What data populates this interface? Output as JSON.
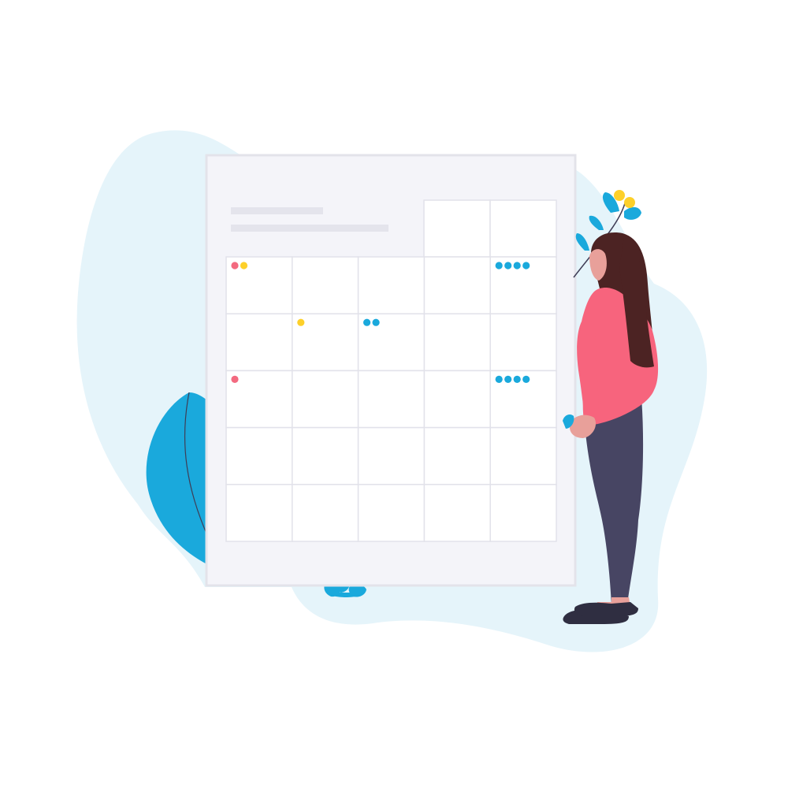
{
  "illustration": {
    "subject": "woman-looking-at-calendar",
    "colors": {
      "background": "#ffffff",
      "blob": "#e5f4fa",
      "board": "#f4f4f9",
      "board_border": "#e3e3ea",
      "cell": "#ffffff",
      "grid_line": "#e2e2ea",
      "placeholder_bar": "#e4e4ec",
      "accent_blue": "#1aa9dc",
      "accent_red": "#f36a80",
      "accent_yellow": "#fdd02a",
      "shirt": "#f7647d",
      "pants": "#474563",
      "hair": "#4c2323",
      "skin": "#e8a09a",
      "shoes": "#2f2e41"
    }
  },
  "calendar": {
    "columns": 5,
    "rows": 5,
    "header_cells": 2,
    "events": [
      {
        "row": 0,
        "col": 0,
        "dots": [
          "red",
          "yellow"
        ]
      },
      {
        "row": 0,
        "col": 4,
        "dots": [
          "blue",
          "blue",
          "blue",
          "blue"
        ]
      },
      {
        "row": 1,
        "col": 1,
        "dots": [
          "yellow"
        ]
      },
      {
        "row": 1,
        "col": 2,
        "dots": [
          "blue",
          "blue"
        ]
      },
      {
        "row": 2,
        "col": 0,
        "dots": [
          "red"
        ]
      },
      {
        "row": 2,
        "col": 4,
        "dots": [
          "blue",
          "blue",
          "blue",
          "blue"
        ]
      }
    ]
  }
}
